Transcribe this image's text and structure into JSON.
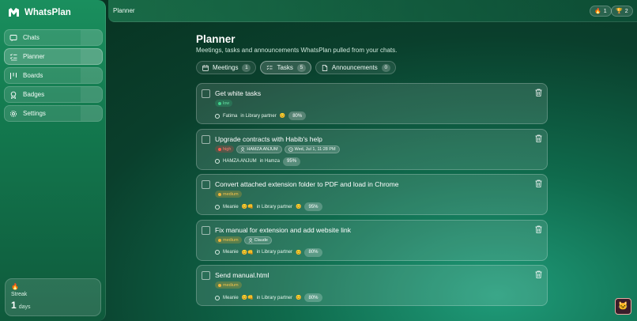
{
  "app": {
    "name": "WhatsPlan",
    "logo_icon": "whatsplan-logo-icon"
  },
  "sidebar": {
    "items": [
      {
        "label": "Chats",
        "icon": "chat-icon"
      },
      {
        "label": "Planner",
        "icon": "checklist-icon",
        "active": true
      },
      {
        "label": "Boards",
        "icon": "board-icon"
      },
      {
        "label": "Badges",
        "icon": "badge-icon"
      },
      {
        "label": "Settings",
        "icon": "gear-icon"
      }
    ],
    "streak": {
      "label": "Streak",
      "value": "1",
      "unit": "days",
      "icon": "flame-icon"
    }
  },
  "topbar": {
    "title": "Planner",
    "badge_streak": {
      "icon": "flame-icon",
      "value": "1"
    },
    "badge_trophy": {
      "icon": "trophy-icon",
      "value": "2"
    }
  },
  "main": {
    "title": "Planner",
    "subtitle": "Meetings, tasks and announcements WhatsPlan pulled from your chats.",
    "tabs": [
      {
        "label": "Meetings",
        "count": "1",
        "icon": "calendar-icon"
      },
      {
        "label": "Tasks",
        "count": "5",
        "icon": "checklist-icon",
        "active": true
      },
      {
        "label": "Announcements",
        "count": "0",
        "icon": "document-icon"
      }
    ],
    "tasks": [
      {
        "title": "Get white tasks",
        "priority": "low",
        "priority_label": "low",
        "chips": [],
        "person": "Fatima",
        "chat": "in Library partner",
        "chat_emoji": "😊",
        "confidence": "80%"
      },
      {
        "title": "Upgrade contracts with Habib's help",
        "priority": "high",
        "priority_label": "high",
        "chips": [
          {
            "icon": "person-icon",
            "text": "HAMZA ANJUM"
          },
          {
            "icon": "clock-icon",
            "text": "Wed, Jul 1, 11:28 PM"
          }
        ],
        "person": "HAMZA ANJUM",
        "chat": "in Hamza",
        "chat_emoji": "",
        "confidence": "95%"
      },
      {
        "title": "Convert attached extension folder to PDF and load in Chrome",
        "priority": "medium",
        "priority_label": "medium",
        "chips": [],
        "person": "Meanie",
        "person_emoji": "😊👊",
        "chat": "in Library partner",
        "chat_emoji": "😊",
        "confidence": "95%"
      },
      {
        "title": "Fix manual for extension and add website link",
        "priority": "medium",
        "priority_label": "medium",
        "chips": [
          {
            "icon": "person-icon",
            "text": "Claude"
          }
        ],
        "person": "Meanie",
        "person_emoji": "😊👊",
        "chat": "in Library partner",
        "chat_emoji": "😊",
        "confidence": "80%"
      },
      {
        "title": "Send manual.html",
        "priority": "medium",
        "priority_label": "medium",
        "chips": [],
        "person": "Meanie",
        "person_emoji": "😊👊",
        "chat": "in Library partner",
        "chat_emoji": "😊",
        "confidence": "80%"
      }
    ]
  },
  "corner_button": {
    "icon": "avatar-icon",
    "emoji": "🐱"
  },
  "colors": {
    "accent": "#1a8f5e",
    "low": "#42d08c",
    "high": "#ff5a4c",
    "medium": "#f0b43c"
  }
}
